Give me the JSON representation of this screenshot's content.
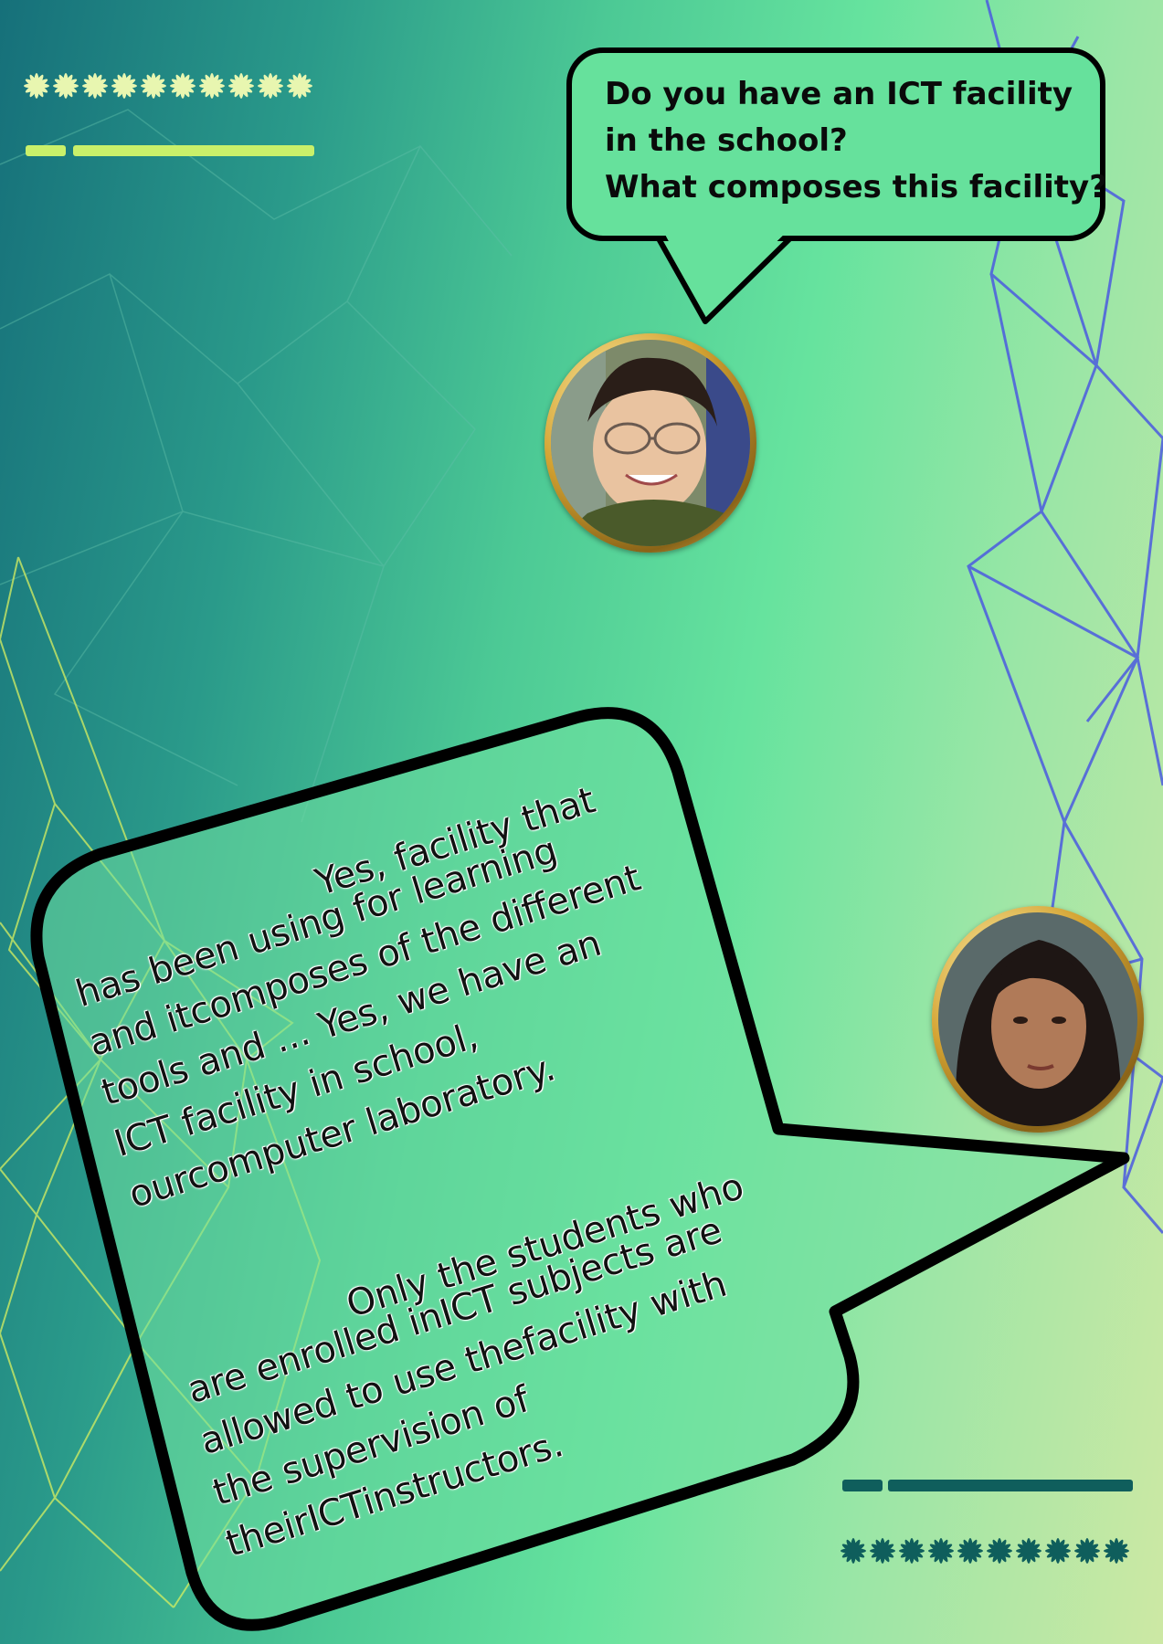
{
  "question_bubble": {
    "lines": [
      "Do you have an ICT facility",
      "in the school?",
      "What composes this facility?"
    ]
  },
  "answer_bubble": {
    "paragraph_1": [
      "Yes, facility that",
      "has been using for learning",
      "and itcomposes of the different",
      "tools and ... Yes, we have an",
      "ICT facility in school,",
      "ourcomputer laboratory."
    ],
    "paragraph_2": [
      "Only the students who",
      "are enrolled inICT subjects are",
      "allowed to use thefacility with",
      "the supervision of",
      "theirICTinstructors."
    ]
  },
  "avatars": {
    "interviewer": "interviewer-photo",
    "student": "student-photo"
  },
  "colors": {
    "bubble_fill": "#66e19c",
    "bubble_stroke": "#000000",
    "avatar_frame": "#d4a332",
    "accent_bar_top": "#c9f06a",
    "accent_bar_bottom": "#0f5e5c"
  }
}
